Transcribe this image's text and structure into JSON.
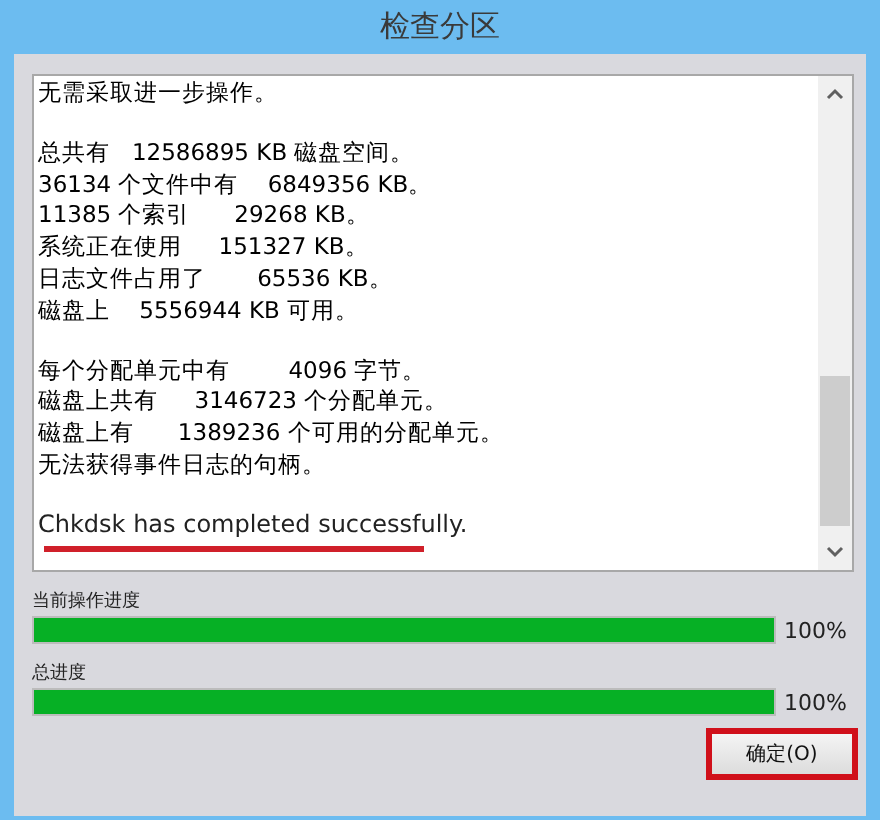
{
  "window": {
    "title": "检查分区"
  },
  "log": {
    "paragraphs": [
      {
        "lines": [
          "无需采取进一步操作。"
        ],
        "highlighted": false
      },
      {
        "lines": [
          "总共有   12586895 KB 磁盘空间。",
          "36134 个文件中有    6849356 KB。",
          "11385 个索引      29268 KB。",
          "系统正在使用     151327 KB。",
          "日志文件占用了       65536 KB。",
          "磁盘上    5556944 KB 可用。"
        ],
        "highlighted": false
      },
      {
        "lines": [
          "每个分配单元中有        4096 字节。",
          "磁盘上共有     3146723 个分配单元。",
          "磁盘上有      1389236 个可用的分配单元。",
          "无法获得事件日志的句柄。"
        ],
        "highlighted": false
      },
      {
        "lines": [
          "Chkdsk has completed successfully."
        ],
        "highlighted": true
      }
    ]
  },
  "progress": [
    {
      "label": "当前操作进度",
      "level": 1,
      "reading": "100%"
    },
    {
      "label": "总进度",
      "level": 1,
      "reading": "100%"
    }
  ],
  "buttons": [
    {
      "label": "确定(O)",
      "highlighted": true
    }
  ]
}
